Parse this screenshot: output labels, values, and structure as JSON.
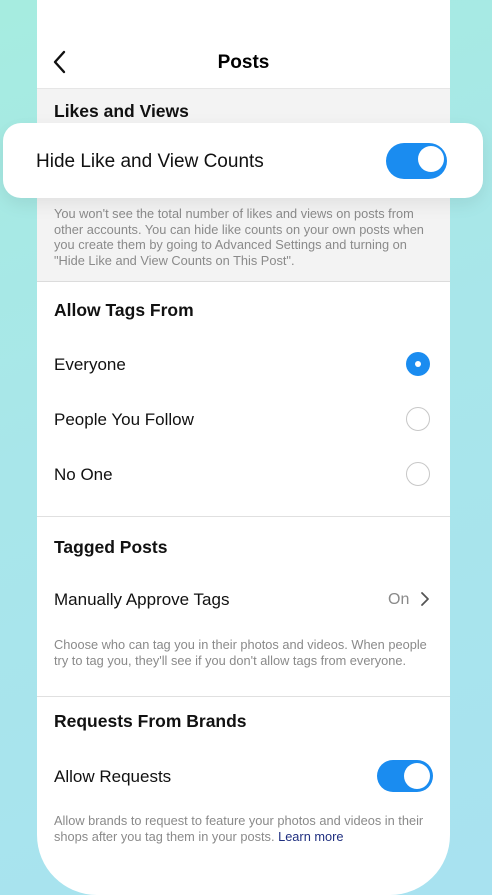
{
  "header": {
    "title": "Posts"
  },
  "likes_views": {
    "title": "Likes and Views",
    "hide_counts_label": "Hide Like and View Counts",
    "hide_counts_on": true,
    "description": "You won't see the total number of likes and views on posts from other accounts. You can hide like counts on your own posts when you create them by going to Advanced Settings and turning on \"Hide Like and View Counts on This Post\"."
  },
  "allow_tags": {
    "title": "Allow Tags From",
    "options": [
      {
        "label": "Everyone",
        "selected": true
      },
      {
        "label": "People You Follow",
        "selected": false
      },
      {
        "label": "No One",
        "selected": false
      }
    ]
  },
  "tagged_posts": {
    "title": "Tagged Posts",
    "manual_approve_label": "Manually Approve Tags",
    "manual_approve_value": "On",
    "description": "Choose who can tag you in their photos and videos. When people try to tag you, they'll see if you don't allow tags from everyone."
  },
  "brands": {
    "title": "Requests From Brands",
    "allow_label": "Allow Requests",
    "allow_on": true,
    "description": "Allow brands to request to feature your photos and videos in their shops after you tag them in your posts.",
    "learn_more": "Learn more"
  },
  "colors": {
    "accent": "#1a8cf0",
    "link": "#1f2f80"
  }
}
